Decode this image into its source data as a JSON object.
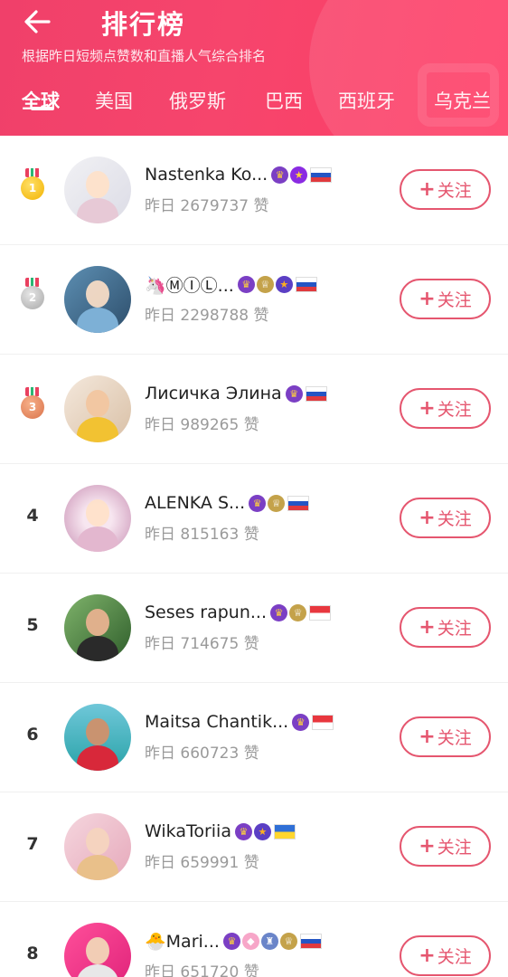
{
  "header": {
    "title": "排行榜",
    "subtitle": "根据昨日短频点赞数和直播人气综合排名"
  },
  "tabs": [
    "全球",
    "美国",
    "俄罗斯",
    "巴西",
    "西班牙",
    "乌克兰"
  ],
  "follow_label": "关注",
  "colors": {
    "accent": "#f0406a",
    "follow": "#e5566f"
  },
  "rows": [
    {
      "rank": "1",
      "name": "Nastenka Ko...",
      "likes": "昨日 2679737 赞",
      "badges": [
        "crown-icon",
        "star-icon"
      ],
      "flag": "russia-flag"
    },
    {
      "rank": "2",
      "name": "🦄ⓂⒾⓁ...",
      "likes": "昨日 2298788 赞",
      "badges": [
        "crown-icon",
        "gold-badge-icon",
        "orange-star-icon"
      ],
      "flag": "russia-flag"
    },
    {
      "rank": "3",
      "name": "Лисичка Элина",
      "likes": "昨日 989265 赞",
      "badges": [
        "crown-icon"
      ],
      "flag": "russia-flag"
    },
    {
      "rank": "4",
      "name": "ALENKA S...",
      "likes": "昨日 815163 赞",
      "badges": [
        "crown-icon",
        "gold-badge-icon"
      ],
      "flag": "russia-flag"
    },
    {
      "rank": "5",
      "name": "Seses rapun...",
      "likes": "昨日 714675 赞",
      "badges": [
        "crown-icon",
        "gold-badge-icon"
      ],
      "flag": "indonesia-flag"
    },
    {
      "rank": "6",
      "name": "Maitsa Chantik...",
      "likes": "昨日 660723 赞",
      "badges": [
        "crown-icon"
      ],
      "flag": "indonesia-flag"
    },
    {
      "rank": "7",
      "name": "WikaToriia",
      "likes": "昨日 659991 赞",
      "badges": [
        "crown-icon",
        "orange-star-icon"
      ],
      "flag": "ukraine-flag"
    },
    {
      "rank": "8",
      "name": "🐣Mari...",
      "likes": "昨日 651720 赞",
      "badges": [
        "crown-icon",
        "diamond-icon",
        "blue-badge-icon",
        "gold-badge-icon"
      ],
      "flag": "russia-flag"
    }
  ]
}
